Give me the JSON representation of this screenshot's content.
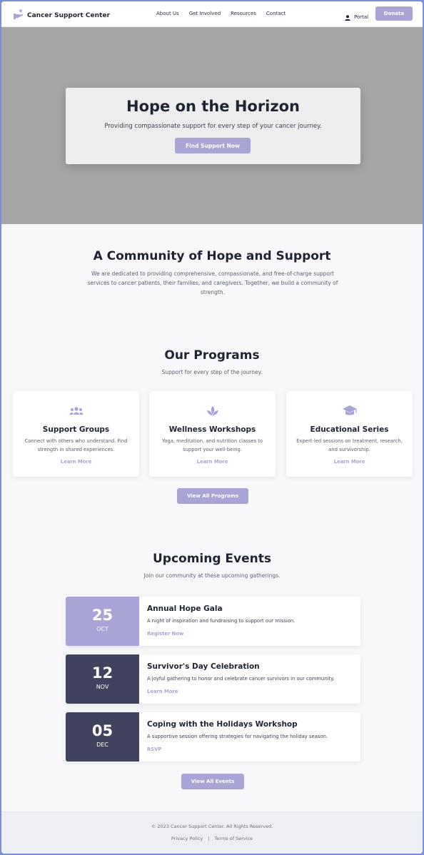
{
  "colors": {
    "accent": "#a9a4d6",
    "dark": "#41435e",
    "text": "#1f2433",
    "muted": "#5a5f6e"
  },
  "header": {
    "logo_icon": "hand-heart-icon",
    "logo_text": "Cancer Support Center",
    "nav": [
      "About Us",
      "Get Involved",
      "Resources",
      "Contact"
    ],
    "portal_icon": "user-icon",
    "portal_label": "Portal",
    "donate_label": "Donate"
  },
  "hero": {
    "title": "Hope on the Horizon",
    "subtitle": "Providing compassionate support for every step of your cancer journey.",
    "cta": "Find Support Now"
  },
  "community": {
    "title": "A Community of Hope and Support",
    "text": "We are dedicated to providing comprehensive, compassionate, and free-of-charge support services to cancer patients, their families, and caregivers. Together, we build a community of strength."
  },
  "programs": {
    "title": "Our Programs",
    "subtitle": "Support for every step of the journey.",
    "items": [
      {
        "icon": "people-group-icon",
        "title": "Support Groups",
        "desc": "Connect with others who understand. Find strength in shared experiences.",
        "link": "Learn More"
      },
      {
        "icon": "lotus-icon",
        "title": "Wellness Workshops",
        "desc": "Yoga, meditation, and nutrition classes to support your well-being.",
        "link": "Learn More"
      },
      {
        "icon": "graduation-cap-icon",
        "title": "Educational Series",
        "desc": "Expert-led sessions on treatment, research, and survivorship.",
        "link": "Learn More"
      }
    ],
    "view_all": "View All Programs"
  },
  "events": {
    "title": "Upcoming Events",
    "subtitle": "Join our community at these upcoming gatherings.",
    "items": [
      {
        "day": "25",
        "month": "OCT",
        "color": "#a9a4d6",
        "name": "Annual Hope Gala",
        "desc": "A night of inspiration and fundraising to support our mission.",
        "link": "Register Now"
      },
      {
        "day": "12",
        "month": "NOV",
        "color": "#41435e",
        "name": "Survivor's Day Celebration",
        "desc": "A joyful gathering to honor and celebrate cancer survivors in our community.",
        "link": "Learn More"
      },
      {
        "day": "05",
        "month": "DEC",
        "color": "#41435e",
        "name": "Coping with the Holidays Workshop",
        "desc": "A supportive session offering strategies for navigating the holiday season.",
        "link": "RSVP"
      }
    ],
    "view_all": "View All Events"
  },
  "footer": {
    "copyright": "© 2023 Cancer Support Center. All Rights Reserved.",
    "privacy": "Privacy Policy",
    "separator": "|",
    "terms": "Terms of Service"
  }
}
